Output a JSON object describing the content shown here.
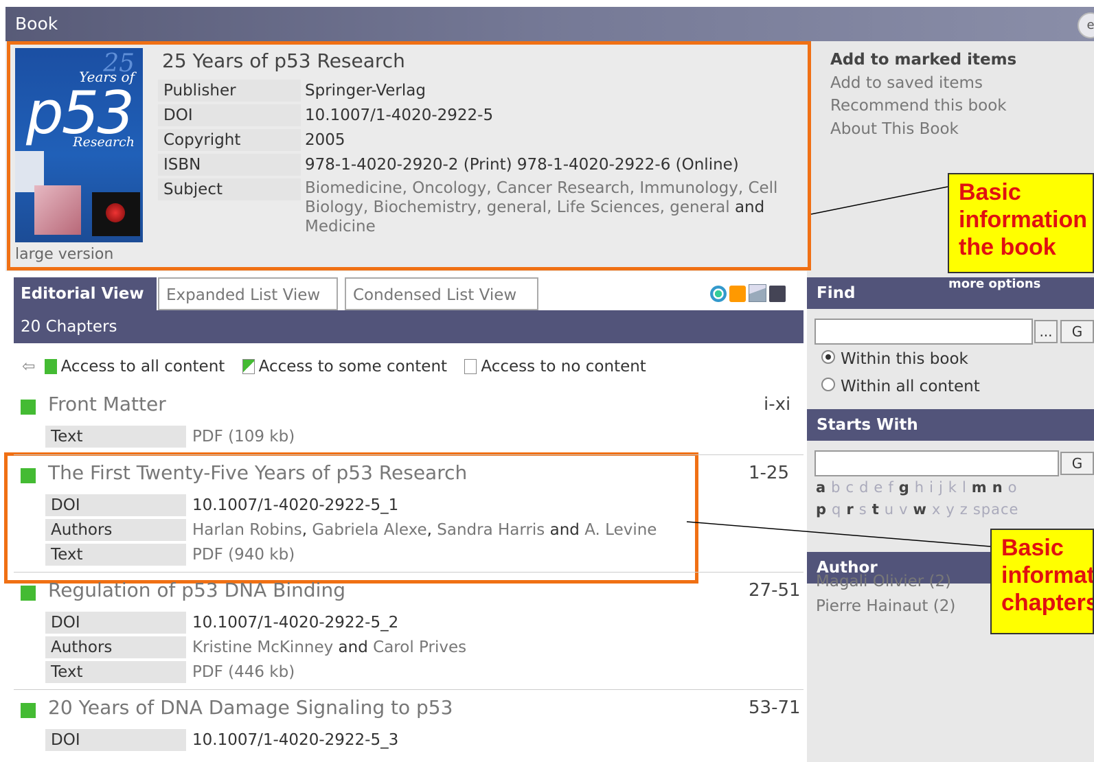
{
  "header": {
    "title": "Book"
  },
  "book": {
    "cover": {
      "big25": "25",
      "years_of": "Years of",
      "p53": "p53",
      "research": "Research"
    },
    "large_version": "large version",
    "title": "25 Years of p53 Research",
    "meta": [
      {
        "label": "Publisher",
        "value": "Springer-Verlag"
      },
      {
        "label": "DOI",
        "value": "10.1007/1-4020-2922-5"
      },
      {
        "label": "Copyright",
        "value": "2005"
      },
      {
        "label": "ISBN",
        "value": "978-1-4020-2920-2 (Print) 978-1-4020-2922-6 (Online)"
      }
    ],
    "subject_label": "Subject",
    "subjects": [
      "Biomedicine",
      "Oncology",
      "Cancer Research",
      "Immunology",
      "Cell Biology",
      "Biochemistry, general",
      "Life Sciences, general",
      "Medicine"
    ],
    "subject_sep": ", ",
    "subject_and": " and "
  },
  "actions": [
    "Add to marked items",
    "Add to saved items",
    "Recommend this book",
    "About This Book"
  ],
  "callouts": {
    "book": "Basic\ninformation of\nthe book",
    "chapter": "Basic\ninformation of\nchapters"
  },
  "tabs": [
    "Editorial View",
    "Expanded List View",
    "Condensed List View"
  ],
  "chapters_count": "20 Chapters",
  "legend": {
    "all": "Access to all content",
    "some": "Access to some content",
    "none": "Access to no content"
  },
  "chapters": [
    {
      "title": "Front Matter",
      "pages": "i-xi",
      "rows": [
        {
          "label": "Text",
          "value": "PDF (109 kb)"
        }
      ]
    },
    {
      "title": "The First Twenty-Five Years of p53 Research",
      "pages": "1-25",
      "rows": [
        {
          "label": "DOI",
          "value": "10.1007/1-4020-2922-5_1"
        },
        {
          "label": "Authors",
          "authors": [
            "Harlan Robins",
            "Gabriela Alexe",
            "Sandra Harris",
            "A. Levine"
          ]
        },
        {
          "label": "Text",
          "value": "PDF (940 kb)"
        }
      ]
    },
    {
      "title": "Regulation of p53 DNA Binding",
      "pages": "27-51",
      "rows": [
        {
          "label": "DOI",
          "value": "10.1007/1-4020-2922-5_2"
        },
        {
          "label": "Authors",
          "authors": [
            "Kristine McKinney",
            "Carol Prives"
          ]
        },
        {
          "label": "Text",
          "value": "PDF (446 kb)"
        }
      ]
    },
    {
      "title": "20 Years of DNA Damage Signaling to p53",
      "pages": "53-71",
      "rows": [
        {
          "label": "DOI",
          "value": "10.1007/1-4020-2922-5_3"
        }
      ]
    }
  ],
  "find": {
    "title": "Find",
    "more": "more options",
    "go": "G",
    "browse": "...",
    "input_value": "",
    "radio_book": "Within this book",
    "radio_all": "Within all content"
  },
  "starts_with": {
    "title": "Starts With",
    "go": "G",
    "input_value": "",
    "row1": [
      {
        "l": "a",
        "on": true
      },
      {
        "l": "b",
        "on": false
      },
      {
        "l": "c",
        "on": false
      },
      {
        "l": "d",
        "on": false
      },
      {
        "l": "e",
        "on": false
      },
      {
        "l": "f",
        "on": false
      },
      {
        "l": "g",
        "on": true
      },
      {
        "l": "h",
        "on": false
      },
      {
        "l": "i",
        "on": false
      },
      {
        "l": "j",
        "on": false
      },
      {
        "l": "k",
        "on": false
      },
      {
        "l": "l",
        "on": false
      },
      {
        "l": "m",
        "on": true
      },
      {
        "l": "n",
        "on": true
      },
      {
        "l": "o",
        "on": false
      }
    ],
    "row2": [
      {
        "l": "p",
        "on": true
      },
      {
        "l": "q",
        "on": false
      },
      {
        "l": "r",
        "on": true
      },
      {
        "l": "s",
        "on": false
      },
      {
        "l": "t",
        "on": true
      },
      {
        "l": "u",
        "on": false
      },
      {
        "l": "v",
        "on": false
      },
      {
        "l": "w",
        "on": true
      },
      {
        "l": "x",
        "on": false
      },
      {
        "l": "y",
        "on": false
      },
      {
        "l": "z",
        "on": false
      },
      {
        "l": "space",
        "on": false
      }
    ]
  },
  "author_panel": {
    "title": "Author",
    "items": [
      "Magali Olivier (2)",
      "Pierre Hainaut (2)"
    ]
  },
  "colors": {
    "orange": "#f07014",
    "header": "#52547a",
    "green": "#44bb33",
    "callout_bg": "#ffff00",
    "callout_text": "#e01010"
  }
}
